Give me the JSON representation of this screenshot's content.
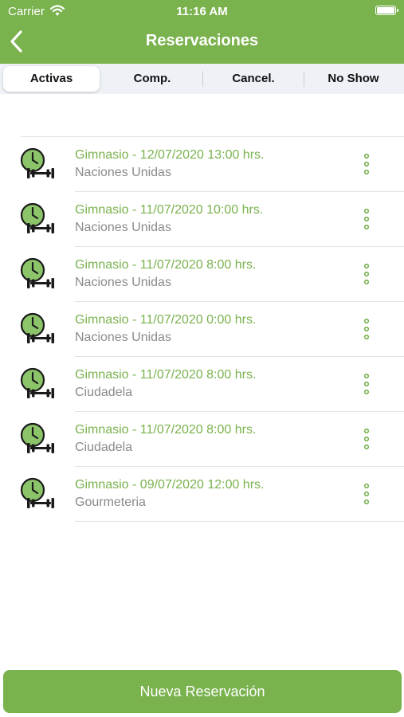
{
  "status_bar": {
    "carrier": "Carrier",
    "time": "11:16 AM"
  },
  "header": {
    "title": "Reservaciones"
  },
  "tabs": [
    {
      "label": "Activas",
      "active": true
    },
    {
      "label": "Comp.",
      "active": false
    },
    {
      "label": "Cancel.",
      "active": false
    },
    {
      "label": "No Show",
      "active": false
    }
  ],
  "reservations": [
    {
      "title": "Gimnasio - 12/07/2020 13:00 hrs.",
      "location": "Naciones Unidas"
    },
    {
      "title": "Gimnasio - 11/07/2020 10:00 hrs.",
      "location": "Naciones Unidas"
    },
    {
      "title": "Gimnasio - 11/07/2020 8:00 hrs.",
      "location": "Naciones Unidas"
    },
    {
      "title": "Gimnasio - 11/07/2020 0:00 hrs.",
      "location": "Naciones Unidas"
    },
    {
      "title": "Gimnasio - 11/07/2020 8:00 hrs.",
      "location": "Ciudadela"
    },
    {
      "title": "Gimnasio - 11/07/2020 8:00 hrs.",
      "location": "Ciudadela"
    },
    {
      "title": "Gimnasio - 09/07/2020 12:00 hrs.",
      "location": "Gourmeteria"
    }
  ],
  "footer": {
    "new_button": "Nueva Reservación"
  },
  "colors": {
    "primary": "#7ab24e",
    "icon_fill": "#8cc46a",
    "secondary_text": "#8a8a8a",
    "segment_bg": "#eef2f7"
  },
  "icons": {
    "back": "chevron-left-icon",
    "row": "gym-clock-icon",
    "more": "more-vertical-icon"
  }
}
